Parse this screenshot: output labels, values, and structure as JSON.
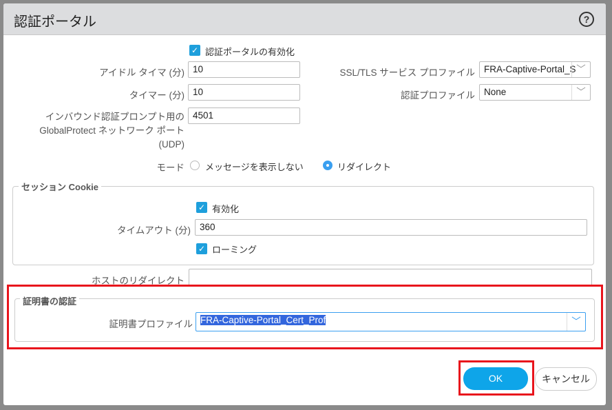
{
  "dialog": {
    "title": "認証ポータル",
    "help_icon": "question-circle-icon"
  },
  "form": {
    "enable_label": "認証ポータルの有効化",
    "enable_checked": true,
    "idle_timer_label": "アイドル タイマ (分)",
    "idle_timer_value": "10",
    "timer_label": "タイマー (分)",
    "timer_value": "10",
    "inbound_label_1": "インバウンド認証プロンプト用の",
    "inbound_label_2": "GlobalProtect ネットワーク ポート",
    "inbound_label_3": "(UDP)",
    "inbound_value": "4501",
    "ssl_label": "SSL/TLS サービス プロファイル",
    "ssl_value": "FRA-Captive-Portal_S",
    "auth_profile_label": "認証プロファイル",
    "auth_profile_value": "None",
    "mode_label": "モード",
    "mode_options": [
      "メッセージを表示しない",
      "リダイレクト"
    ],
    "mode_selected": "リダイレクト"
  },
  "session_cookie": {
    "legend": "セッション Cookie",
    "enable_label": "有効化",
    "enable_checked": true,
    "timeout_label": "タイムアウト (分)",
    "timeout_value": "360",
    "roaming_label": "ローミング",
    "roaming_checked": true
  },
  "host_redirect": {
    "label": "ホストのリダイレクト",
    "value": ""
  },
  "cert_auth": {
    "legend": "証明書の認証",
    "profile_label": "証明書プロファイル",
    "profile_value": "FRA-Captive-Portal_Cert_Prof"
  },
  "buttons": {
    "ok": "OK",
    "cancel": "キャンセル"
  },
  "colors": {
    "accent": "#0ea5e9",
    "highlight": "#e8141c",
    "checkbox": "#1e9fdc"
  }
}
